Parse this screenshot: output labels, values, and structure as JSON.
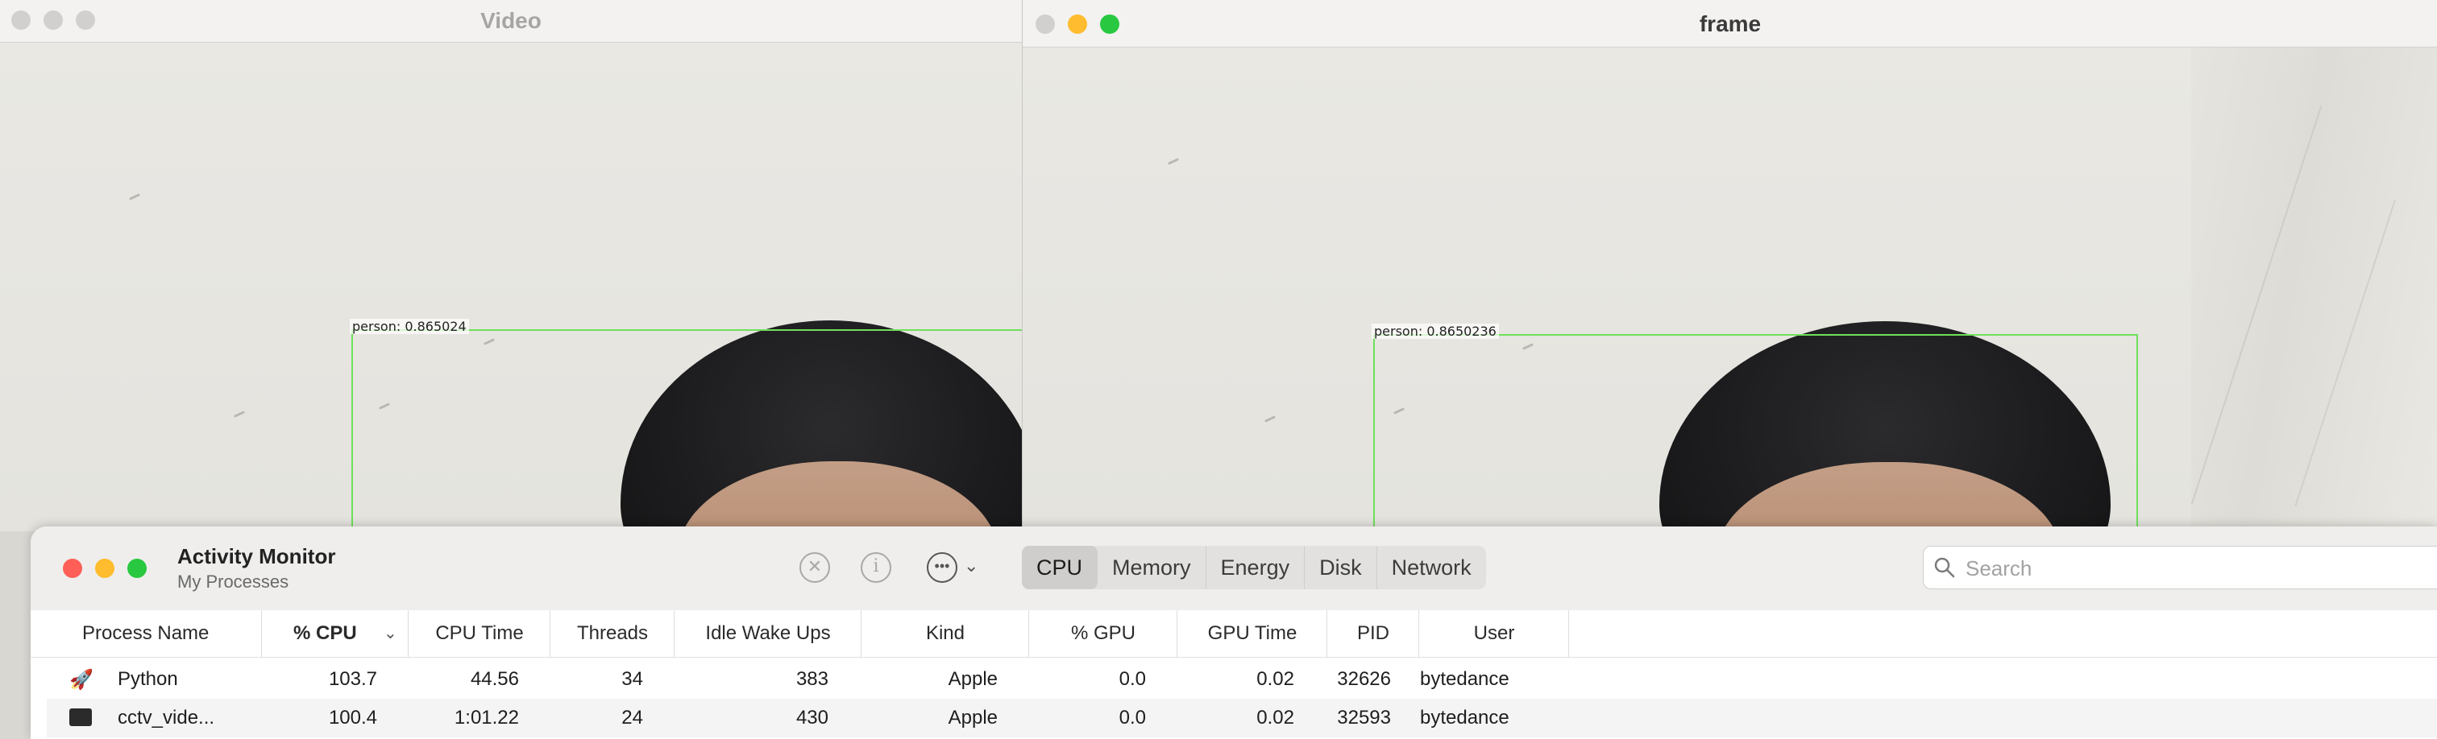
{
  "video_window": {
    "title": "Video",
    "detection_label": "person: 0.865024"
  },
  "frame_window": {
    "title": "frame",
    "detection_label": "person: 0.8650236"
  },
  "activity_monitor": {
    "title": "Activity Monitor",
    "subtitle": "My Processes",
    "tabs": [
      "CPU",
      "Memory",
      "Energy",
      "Disk",
      "Network"
    ],
    "active_tab": "CPU",
    "search_placeholder": "Search",
    "columns": [
      "Process Name",
      "% CPU",
      "CPU Time",
      "Threads",
      "Idle Wake Ups",
      "Kind",
      "% GPU",
      "GPU Time",
      "PID",
      "User"
    ],
    "sort_column": "% CPU",
    "rows": [
      {
        "name": "Python",
        "icon": "python-rocket-icon",
        "cpu": "103.7",
        "cpu_time": "44.56",
        "threads": "34",
        "idle_wake_ups": "383",
        "kind": "Apple",
        "gpu": "0.0",
        "gpu_time": "0.02",
        "pid": "32626",
        "user": "bytedance"
      },
      {
        "name": "cctv_vide...",
        "icon": "terminal-icon",
        "cpu": "100.4",
        "cpu_time": "1:01.22",
        "threads": "24",
        "idle_wake_ups": "430",
        "kind": "Apple",
        "gpu": "0.0",
        "gpu_time": "0.02",
        "pid": "32593",
        "user": "bytedance"
      }
    ]
  },
  "colors": {
    "traffic_close": "#ff5f57",
    "traffic_minimize": "#febc2e",
    "traffic_zoom": "#28c840",
    "traffic_inactive": "#d1d0ce",
    "detection_box": "#6fe05a"
  }
}
